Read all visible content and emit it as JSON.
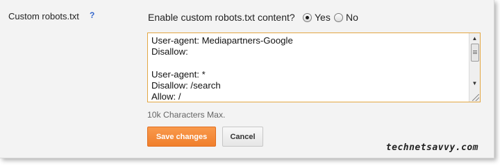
{
  "setting": {
    "label": "Custom robots.txt",
    "help": "?"
  },
  "enable": {
    "question": "Enable custom robots.txt content?",
    "options": [
      {
        "label": "Yes",
        "checked": true
      },
      {
        "label": "No",
        "checked": false
      }
    ]
  },
  "robots_text": "User-agent: Mediapartners-Google\nDisallow:\n\nUser-agent: *\nDisallow: /search\nAllow: /",
  "char_limit_note": "10k Characters Max.",
  "buttons": {
    "save": "Save changes",
    "cancel": "Cancel"
  },
  "watermark": "technetsavvy.com",
  "colors": {
    "accent": "#f07f2c",
    "textarea_border": "#e3a641",
    "help_link": "#3366cc"
  }
}
